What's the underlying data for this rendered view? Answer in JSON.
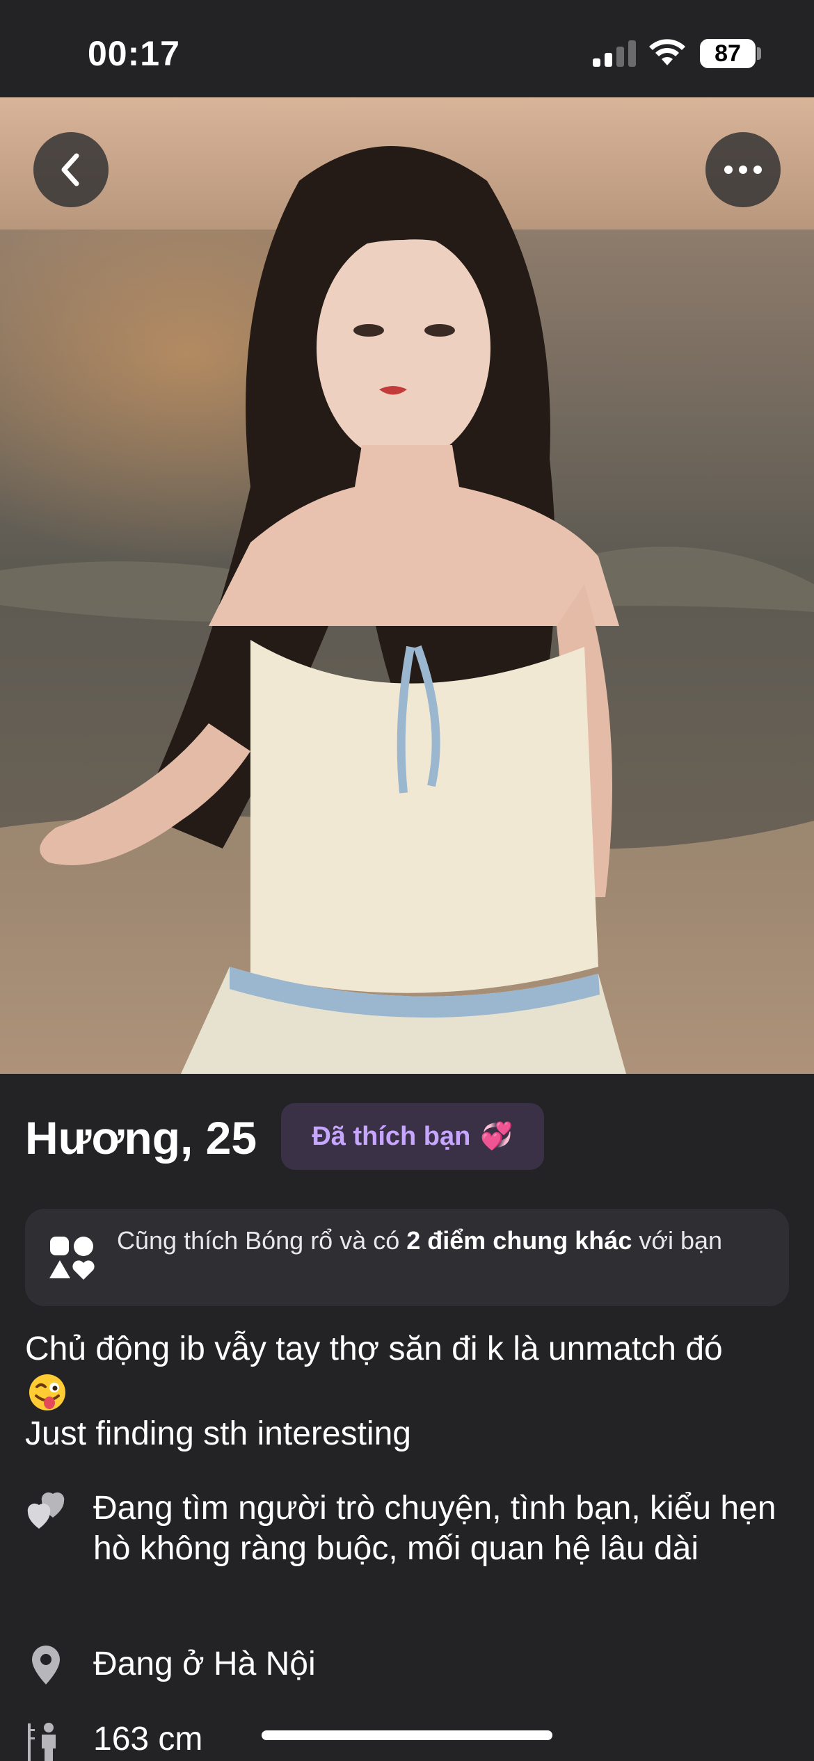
{
  "status_bar": {
    "time": "00:17",
    "battery": "87"
  },
  "photo": {
    "back_icon": "chevron-left-icon",
    "more_icon": "ellipsis-icon"
  },
  "profile": {
    "name_age": "Hương, 25",
    "liked_badge": "Đã thích bạn",
    "liked_badge_emoji": "💞"
  },
  "common_card": {
    "prefix": "Cũng thích Bóng rổ và có ",
    "highlight": "2 điểm chung khác",
    "suffix": " với bạn",
    "icon": "shapes-icon"
  },
  "bio": {
    "line1": "Chủ động ib vẫy tay thợ săn đi k là unmatch đó",
    "emoji": "😜",
    "line2": "Just finding sth interesting"
  },
  "details": {
    "looking_for": "Đang tìm người trò chuyện, tình bạn, kiểu hẹn hò không ràng buộc, mối quan hệ lâu dài",
    "location": "Đang ở Hà Nội",
    "height": "163 cm"
  },
  "colors": {
    "background": "#232326",
    "badge_bg": "#3b3147",
    "badge_text": "#c7a6ff",
    "card_bg": "#2f2f33"
  }
}
